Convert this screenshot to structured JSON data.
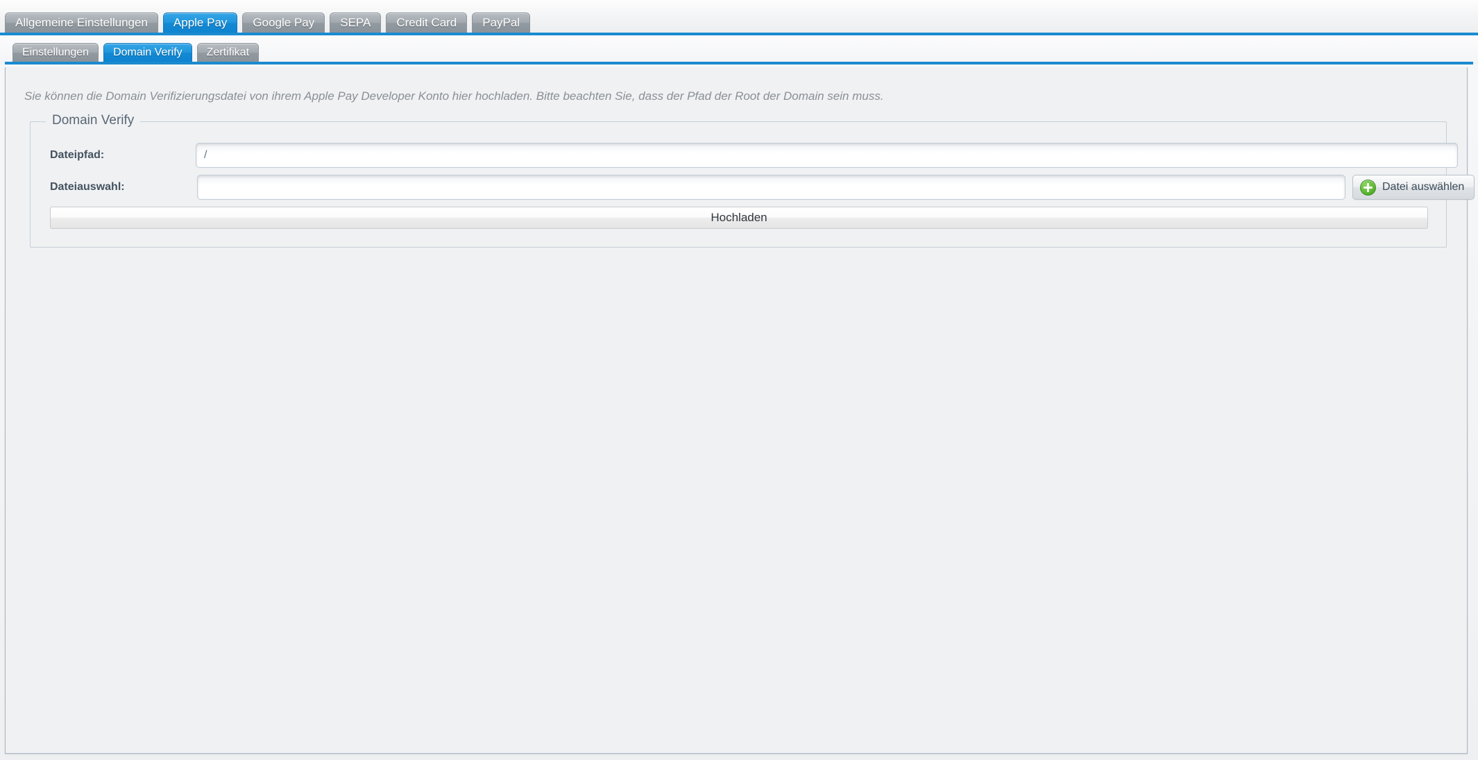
{
  "primary_tabs": [
    {
      "label": "Allgemeine Einstellungen",
      "active": false
    },
    {
      "label": "Apple Pay",
      "active": true
    },
    {
      "label": "Google Pay",
      "active": false
    },
    {
      "label": "SEPA",
      "active": false
    },
    {
      "label": "Credit Card",
      "active": false
    },
    {
      "label": "PayPal",
      "active": false
    }
  ],
  "secondary_tabs": [
    {
      "label": "Einstellungen",
      "active": false
    },
    {
      "label": "Domain Verify",
      "active": true
    },
    {
      "label": "Zertifikat",
      "active": false
    }
  ],
  "content": {
    "intro": "Sie können die Domain Verifizierungsdatei von ihrem Apple Pay Developer Konto hier hochladen. Bitte beachten Sie, dass der Pfad der Root der Domain sein muss.",
    "fieldset_legend": "Domain Verify",
    "fields": {
      "path": {
        "label": "Dateipfad:",
        "value": "/",
        "placeholder": ""
      },
      "file": {
        "label": "Dateiauswahl:",
        "value": "",
        "placeholder": ""
      }
    },
    "choose_file_button": {
      "label": "Datei auswählen",
      "icon": "plus-circle-icon"
    },
    "upload_button": {
      "label": "Hochladen"
    }
  },
  "colors": {
    "accent_blue": "#1b8bd0",
    "tab_inactive": "#9aa2a9",
    "panel_bg": "#eff1f3",
    "label_text": "#44525f",
    "intro_text": "#8a8f94",
    "plus_green": "#5fbb33"
  }
}
